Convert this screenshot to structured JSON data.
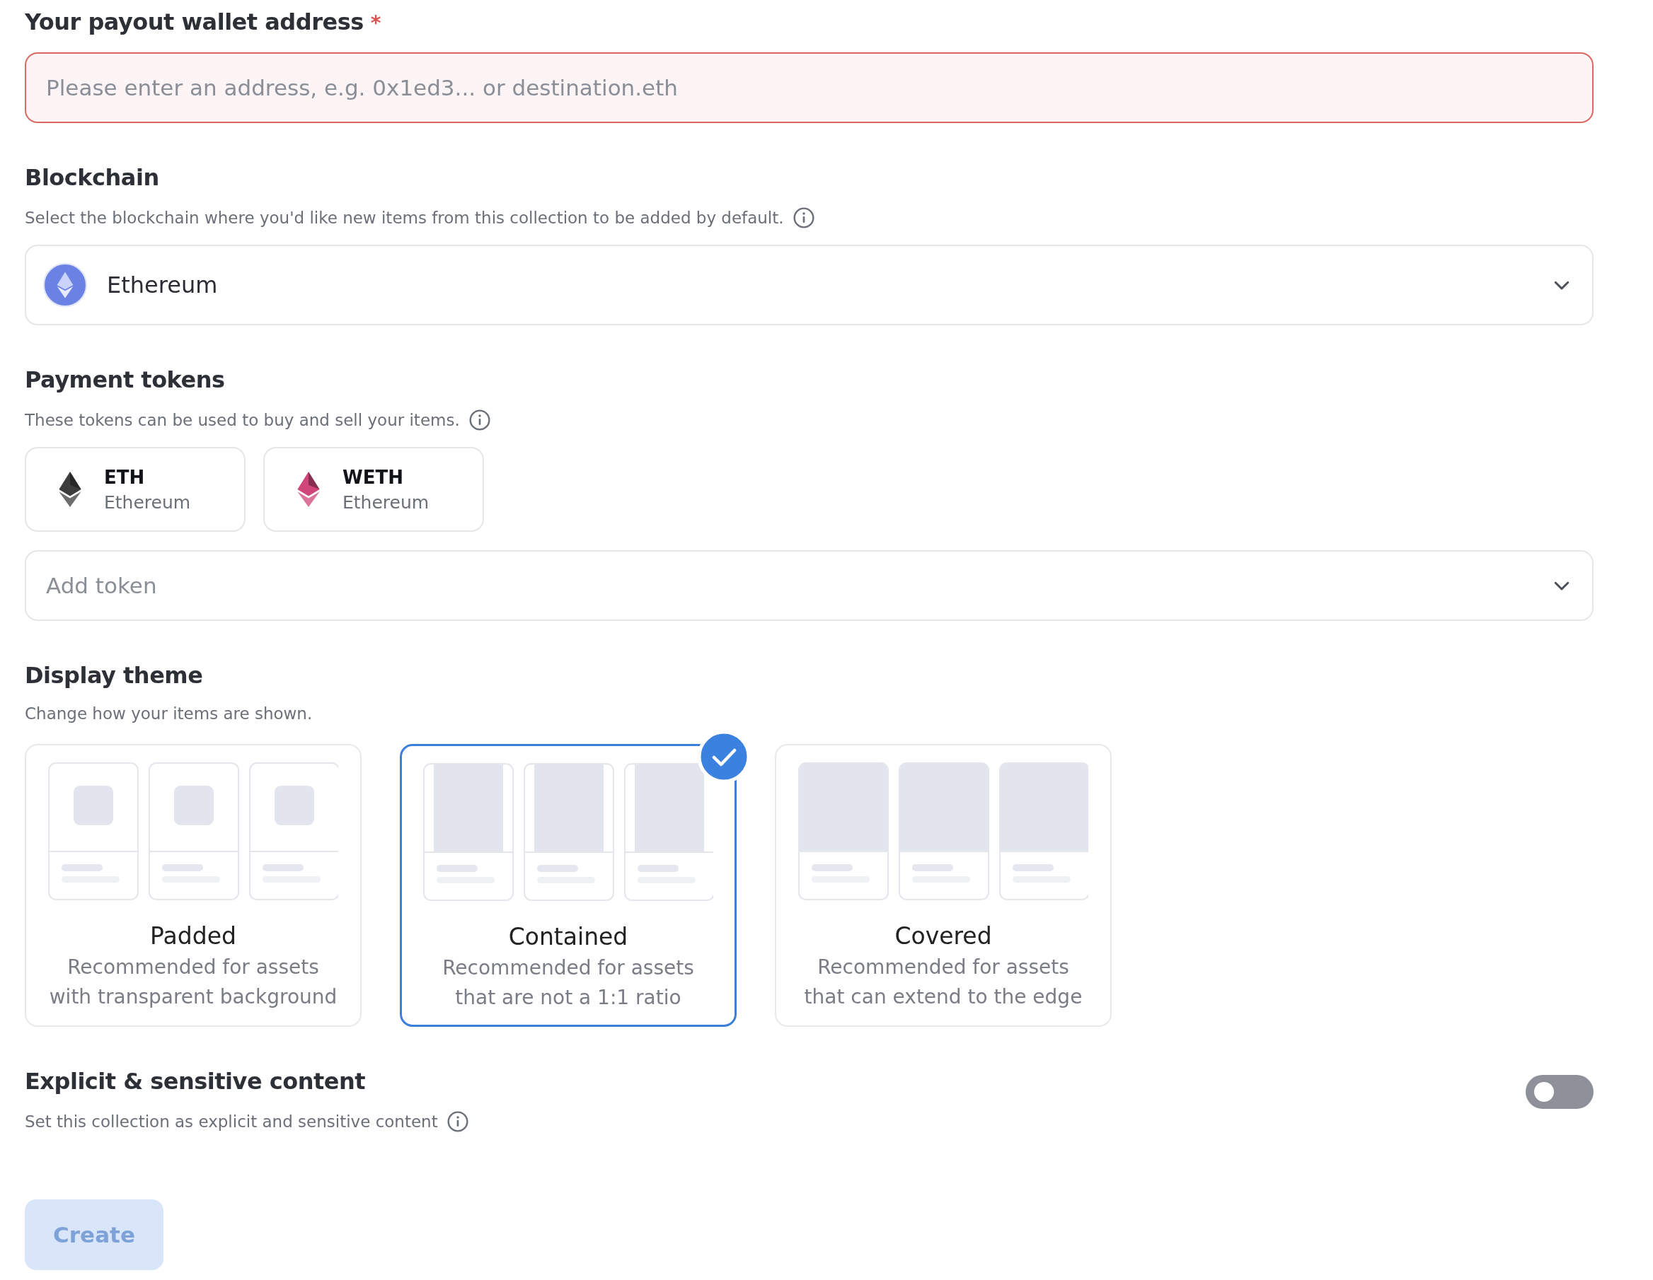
{
  "payout": {
    "label": "Your payout wallet address",
    "required_mark": "*",
    "placeholder": "Please enter an address, e.g. 0x1ed3... or destination.eth",
    "error": true
  },
  "blockchain": {
    "heading": "Blockchain",
    "description": "Select the blockchain where you'd like new items from this collection to be added by default.",
    "value": "Ethereum"
  },
  "payment_tokens": {
    "heading": "Payment tokens",
    "description": "These tokens can be used to buy and sell your items.",
    "tokens": [
      {
        "symbol": "ETH",
        "network": "Ethereum",
        "color": "#3c3c3d"
      },
      {
        "symbol": "WETH",
        "network": "Ethereum",
        "color": "#d0467a"
      }
    ],
    "add_placeholder": "Add token"
  },
  "display_theme": {
    "heading": "Display theme",
    "description": "Change how your items are shown.",
    "options": [
      {
        "kind": "padded",
        "title": "Padded",
        "description": "Recommended for assets with transparent background",
        "selected": false
      },
      {
        "kind": "contained",
        "title": "Contained",
        "description": "Recommended for assets that are not a 1:1 ratio",
        "selected": true
      },
      {
        "kind": "covered",
        "title": "Covered",
        "description": "Recommended for assets that can extend to the edge",
        "selected": false
      }
    ]
  },
  "explicit": {
    "heading": "Explicit & sensitive content",
    "description": "Set this collection as explicit and sensitive content",
    "on": false
  },
  "create_button": {
    "label": "Create",
    "disabled": true
  }
}
